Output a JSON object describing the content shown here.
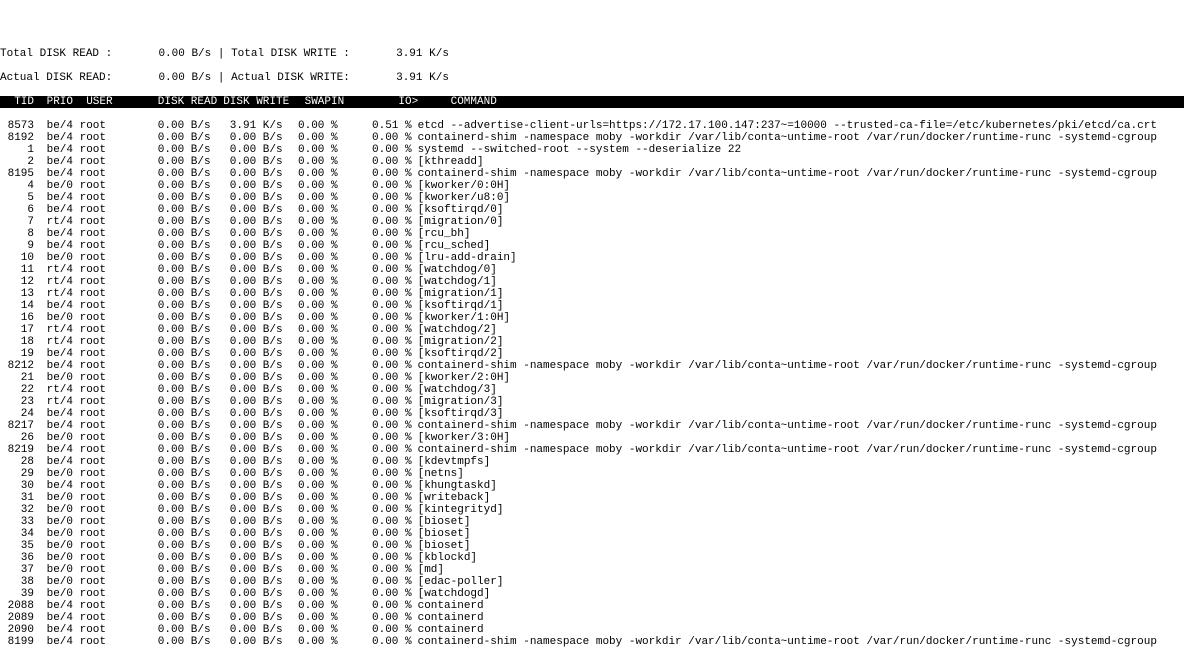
{
  "summary": {
    "total_read_label": "Total DISK READ :",
    "total_read_value": "0.00 B/s",
    "total_write_label": "Total DISK WRITE :",
    "total_write_value": "3.91 K/s",
    "actual_read_label": "Actual DISK READ:",
    "actual_read_value": "0.00 B/s",
    "actual_write_label": "Actual DISK WRITE:",
    "actual_write_value": "3.91 K/s"
  },
  "columns": {
    "tid": "TID",
    "prio": "PRIO",
    "user": "USER",
    "disk_read": "DISK READ",
    "disk_write": "DISK WRITE",
    "swapin": "SWAPIN",
    "io": "IO>",
    "command": "COMMAND"
  },
  "rows": [
    {
      "tid": "8573",
      "prio": "be/4",
      "user": "root",
      "dr": "0.00 B/s",
      "dw": "3.91 K/s",
      "sw": "0.00 %",
      "io": "0.51 %",
      "cmd": "etcd --advertise-client-urls=https://172.17.100.147:237~=10000 --trusted-ca-file=/etc/kubernetes/pki/etcd/ca.crt"
    },
    {
      "tid": "8192",
      "prio": "be/4",
      "user": "root",
      "dr": "0.00 B/s",
      "dw": "0.00 B/s",
      "sw": "0.00 %",
      "io": "0.00 %",
      "cmd": "containerd-shim -namespace moby -workdir /var/lib/conta~untime-root /var/run/docker/runtime-runc -systemd-cgroup"
    },
    {
      "tid": "1",
      "prio": "be/4",
      "user": "root",
      "dr": "0.00 B/s",
      "dw": "0.00 B/s",
      "sw": "0.00 %",
      "io": "0.00 %",
      "cmd": "systemd --switched-root --system --deserialize 22"
    },
    {
      "tid": "2",
      "prio": "be/4",
      "user": "root",
      "dr": "0.00 B/s",
      "dw": "0.00 B/s",
      "sw": "0.00 %",
      "io": "0.00 %",
      "cmd": "[kthreadd]"
    },
    {
      "tid": "8195",
      "prio": "be/4",
      "user": "root",
      "dr": "0.00 B/s",
      "dw": "0.00 B/s",
      "sw": "0.00 %",
      "io": "0.00 %",
      "cmd": "containerd-shim -namespace moby -workdir /var/lib/conta~untime-root /var/run/docker/runtime-runc -systemd-cgroup"
    },
    {
      "tid": "4",
      "prio": "be/0",
      "user": "root",
      "dr": "0.00 B/s",
      "dw": "0.00 B/s",
      "sw": "0.00 %",
      "io": "0.00 %",
      "cmd": "[kworker/0:0H]"
    },
    {
      "tid": "5",
      "prio": "be/4",
      "user": "root",
      "dr": "0.00 B/s",
      "dw": "0.00 B/s",
      "sw": "0.00 %",
      "io": "0.00 %",
      "cmd": "[kworker/u8:0]"
    },
    {
      "tid": "6",
      "prio": "be/4",
      "user": "root",
      "dr": "0.00 B/s",
      "dw": "0.00 B/s",
      "sw": "0.00 %",
      "io": "0.00 %",
      "cmd": "[ksoftirqd/0]"
    },
    {
      "tid": "7",
      "prio": "rt/4",
      "user": "root",
      "dr": "0.00 B/s",
      "dw": "0.00 B/s",
      "sw": "0.00 %",
      "io": "0.00 %",
      "cmd": "[migration/0]"
    },
    {
      "tid": "8",
      "prio": "be/4",
      "user": "root",
      "dr": "0.00 B/s",
      "dw": "0.00 B/s",
      "sw": "0.00 %",
      "io": "0.00 %",
      "cmd": "[rcu_bh]"
    },
    {
      "tid": "9",
      "prio": "be/4",
      "user": "root",
      "dr": "0.00 B/s",
      "dw": "0.00 B/s",
      "sw": "0.00 %",
      "io": "0.00 %",
      "cmd": "[rcu_sched]"
    },
    {
      "tid": "10",
      "prio": "be/0",
      "user": "root",
      "dr": "0.00 B/s",
      "dw": "0.00 B/s",
      "sw": "0.00 %",
      "io": "0.00 %",
      "cmd": "[lru-add-drain]"
    },
    {
      "tid": "11",
      "prio": "rt/4",
      "user": "root",
      "dr": "0.00 B/s",
      "dw": "0.00 B/s",
      "sw": "0.00 %",
      "io": "0.00 %",
      "cmd": "[watchdog/0]"
    },
    {
      "tid": "12",
      "prio": "rt/4",
      "user": "root",
      "dr": "0.00 B/s",
      "dw": "0.00 B/s",
      "sw": "0.00 %",
      "io": "0.00 %",
      "cmd": "[watchdog/1]"
    },
    {
      "tid": "13",
      "prio": "rt/4",
      "user": "root",
      "dr": "0.00 B/s",
      "dw": "0.00 B/s",
      "sw": "0.00 %",
      "io": "0.00 %",
      "cmd": "[migration/1]"
    },
    {
      "tid": "14",
      "prio": "be/4",
      "user": "root",
      "dr": "0.00 B/s",
      "dw": "0.00 B/s",
      "sw": "0.00 %",
      "io": "0.00 %",
      "cmd": "[ksoftirqd/1]"
    },
    {
      "tid": "16",
      "prio": "be/0",
      "user": "root",
      "dr": "0.00 B/s",
      "dw": "0.00 B/s",
      "sw": "0.00 %",
      "io": "0.00 %",
      "cmd": "[kworker/1:0H]"
    },
    {
      "tid": "17",
      "prio": "rt/4",
      "user": "root",
      "dr": "0.00 B/s",
      "dw": "0.00 B/s",
      "sw": "0.00 %",
      "io": "0.00 %",
      "cmd": "[watchdog/2]"
    },
    {
      "tid": "18",
      "prio": "rt/4",
      "user": "root",
      "dr": "0.00 B/s",
      "dw": "0.00 B/s",
      "sw": "0.00 %",
      "io": "0.00 %",
      "cmd": "[migration/2]"
    },
    {
      "tid": "19",
      "prio": "be/4",
      "user": "root",
      "dr": "0.00 B/s",
      "dw": "0.00 B/s",
      "sw": "0.00 %",
      "io": "0.00 %",
      "cmd": "[ksoftirqd/2]"
    },
    {
      "tid": "8212",
      "prio": "be/4",
      "user": "root",
      "dr": "0.00 B/s",
      "dw": "0.00 B/s",
      "sw": "0.00 %",
      "io": "0.00 %",
      "cmd": "containerd-shim -namespace moby -workdir /var/lib/conta~untime-root /var/run/docker/runtime-runc -systemd-cgroup"
    },
    {
      "tid": "21",
      "prio": "be/0",
      "user": "root",
      "dr": "0.00 B/s",
      "dw": "0.00 B/s",
      "sw": "0.00 %",
      "io": "0.00 %",
      "cmd": "[kworker/2:0H]"
    },
    {
      "tid": "22",
      "prio": "rt/4",
      "user": "root",
      "dr": "0.00 B/s",
      "dw": "0.00 B/s",
      "sw": "0.00 %",
      "io": "0.00 %",
      "cmd": "[watchdog/3]"
    },
    {
      "tid": "23",
      "prio": "rt/4",
      "user": "root",
      "dr": "0.00 B/s",
      "dw": "0.00 B/s",
      "sw": "0.00 %",
      "io": "0.00 %",
      "cmd": "[migration/3]"
    },
    {
      "tid": "24",
      "prio": "be/4",
      "user": "root",
      "dr": "0.00 B/s",
      "dw": "0.00 B/s",
      "sw": "0.00 %",
      "io": "0.00 %",
      "cmd": "[ksoftirqd/3]"
    },
    {
      "tid": "8217",
      "prio": "be/4",
      "user": "root",
      "dr": "0.00 B/s",
      "dw": "0.00 B/s",
      "sw": "0.00 %",
      "io": "0.00 %",
      "cmd": "containerd-shim -namespace moby -workdir /var/lib/conta~untime-root /var/run/docker/runtime-runc -systemd-cgroup"
    },
    {
      "tid": "26",
      "prio": "be/0",
      "user": "root",
      "dr": "0.00 B/s",
      "dw": "0.00 B/s",
      "sw": "0.00 %",
      "io": "0.00 %",
      "cmd": "[kworker/3:0H]"
    },
    {
      "tid": "8219",
      "prio": "be/4",
      "user": "root",
      "dr": "0.00 B/s",
      "dw": "0.00 B/s",
      "sw": "0.00 %",
      "io": "0.00 %",
      "cmd": "containerd-shim -namespace moby -workdir /var/lib/conta~untime-root /var/run/docker/runtime-runc -systemd-cgroup"
    },
    {
      "tid": "28",
      "prio": "be/4",
      "user": "root",
      "dr": "0.00 B/s",
      "dw": "0.00 B/s",
      "sw": "0.00 %",
      "io": "0.00 %",
      "cmd": "[kdevtmpfs]"
    },
    {
      "tid": "29",
      "prio": "be/0",
      "user": "root",
      "dr": "0.00 B/s",
      "dw": "0.00 B/s",
      "sw": "0.00 %",
      "io": "0.00 %",
      "cmd": "[netns]"
    },
    {
      "tid": "30",
      "prio": "be/4",
      "user": "root",
      "dr": "0.00 B/s",
      "dw": "0.00 B/s",
      "sw": "0.00 %",
      "io": "0.00 %",
      "cmd": "[khungtaskd]"
    },
    {
      "tid": "31",
      "prio": "be/0",
      "user": "root",
      "dr": "0.00 B/s",
      "dw": "0.00 B/s",
      "sw": "0.00 %",
      "io": "0.00 %",
      "cmd": "[writeback]"
    },
    {
      "tid": "32",
      "prio": "be/0",
      "user": "root",
      "dr": "0.00 B/s",
      "dw": "0.00 B/s",
      "sw": "0.00 %",
      "io": "0.00 %",
      "cmd": "[kintegrityd]"
    },
    {
      "tid": "33",
      "prio": "be/0",
      "user": "root",
      "dr": "0.00 B/s",
      "dw": "0.00 B/s",
      "sw": "0.00 %",
      "io": "0.00 %",
      "cmd": "[bioset]"
    },
    {
      "tid": "34",
      "prio": "be/0",
      "user": "root",
      "dr": "0.00 B/s",
      "dw": "0.00 B/s",
      "sw": "0.00 %",
      "io": "0.00 %",
      "cmd": "[bioset]"
    },
    {
      "tid": "35",
      "prio": "be/0",
      "user": "root",
      "dr": "0.00 B/s",
      "dw": "0.00 B/s",
      "sw": "0.00 %",
      "io": "0.00 %",
      "cmd": "[bioset]"
    },
    {
      "tid": "36",
      "prio": "be/0",
      "user": "root",
      "dr": "0.00 B/s",
      "dw": "0.00 B/s",
      "sw": "0.00 %",
      "io": "0.00 %",
      "cmd": "[kblockd]"
    },
    {
      "tid": "37",
      "prio": "be/0",
      "user": "root",
      "dr": "0.00 B/s",
      "dw": "0.00 B/s",
      "sw": "0.00 %",
      "io": "0.00 %",
      "cmd": "[md]"
    },
    {
      "tid": "38",
      "prio": "be/0",
      "user": "root",
      "dr": "0.00 B/s",
      "dw": "0.00 B/s",
      "sw": "0.00 %",
      "io": "0.00 %",
      "cmd": "[edac-poller]"
    },
    {
      "tid": "39",
      "prio": "be/0",
      "user": "root",
      "dr": "0.00 B/s",
      "dw": "0.00 B/s",
      "sw": "0.00 %",
      "io": "0.00 %",
      "cmd": "[watchdogd]"
    },
    {
      "tid": "2088",
      "prio": "be/4",
      "user": "root",
      "dr": "0.00 B/s",
      "dw": "0.00 B/s",
      "sw": "0.00 %",
      "io": "0.00 %",
      "cmd": "containerd"
    },
    {
      "tid": "2089",
      "prio": "be/4",
      "user": "root",
      "dr": "0.00 B/s",
      "dw": "0.00 B/s",
      "sw": "0.00 %",
      "io": "0.00 %",
      "cmd": "containerd"
    },
    {
      "tid": "2090",
      "prio": "be/4",
      "user": "root",
      "dr": "0.00 B/s",
      "dw": "0.00 B/s",
      "sw": "0.00 %",
      "io": "0.00 %",
      "cmd": "containerd"
    },
    {
      "tid": "8199",
      "prio": "be/4",
      "user": "root",
      "dr": "0.00 B/s",
      "dw": "0.00 B/s",
      "sw": "0.00 %",
      "io": "0.00 %",
      "cmd": "containerd-shim -namespace moby -workdir /var/lib/conta~untime-root /var/run/docker/runtime-runc -systemd-cgroup"
    }
  ]
}
